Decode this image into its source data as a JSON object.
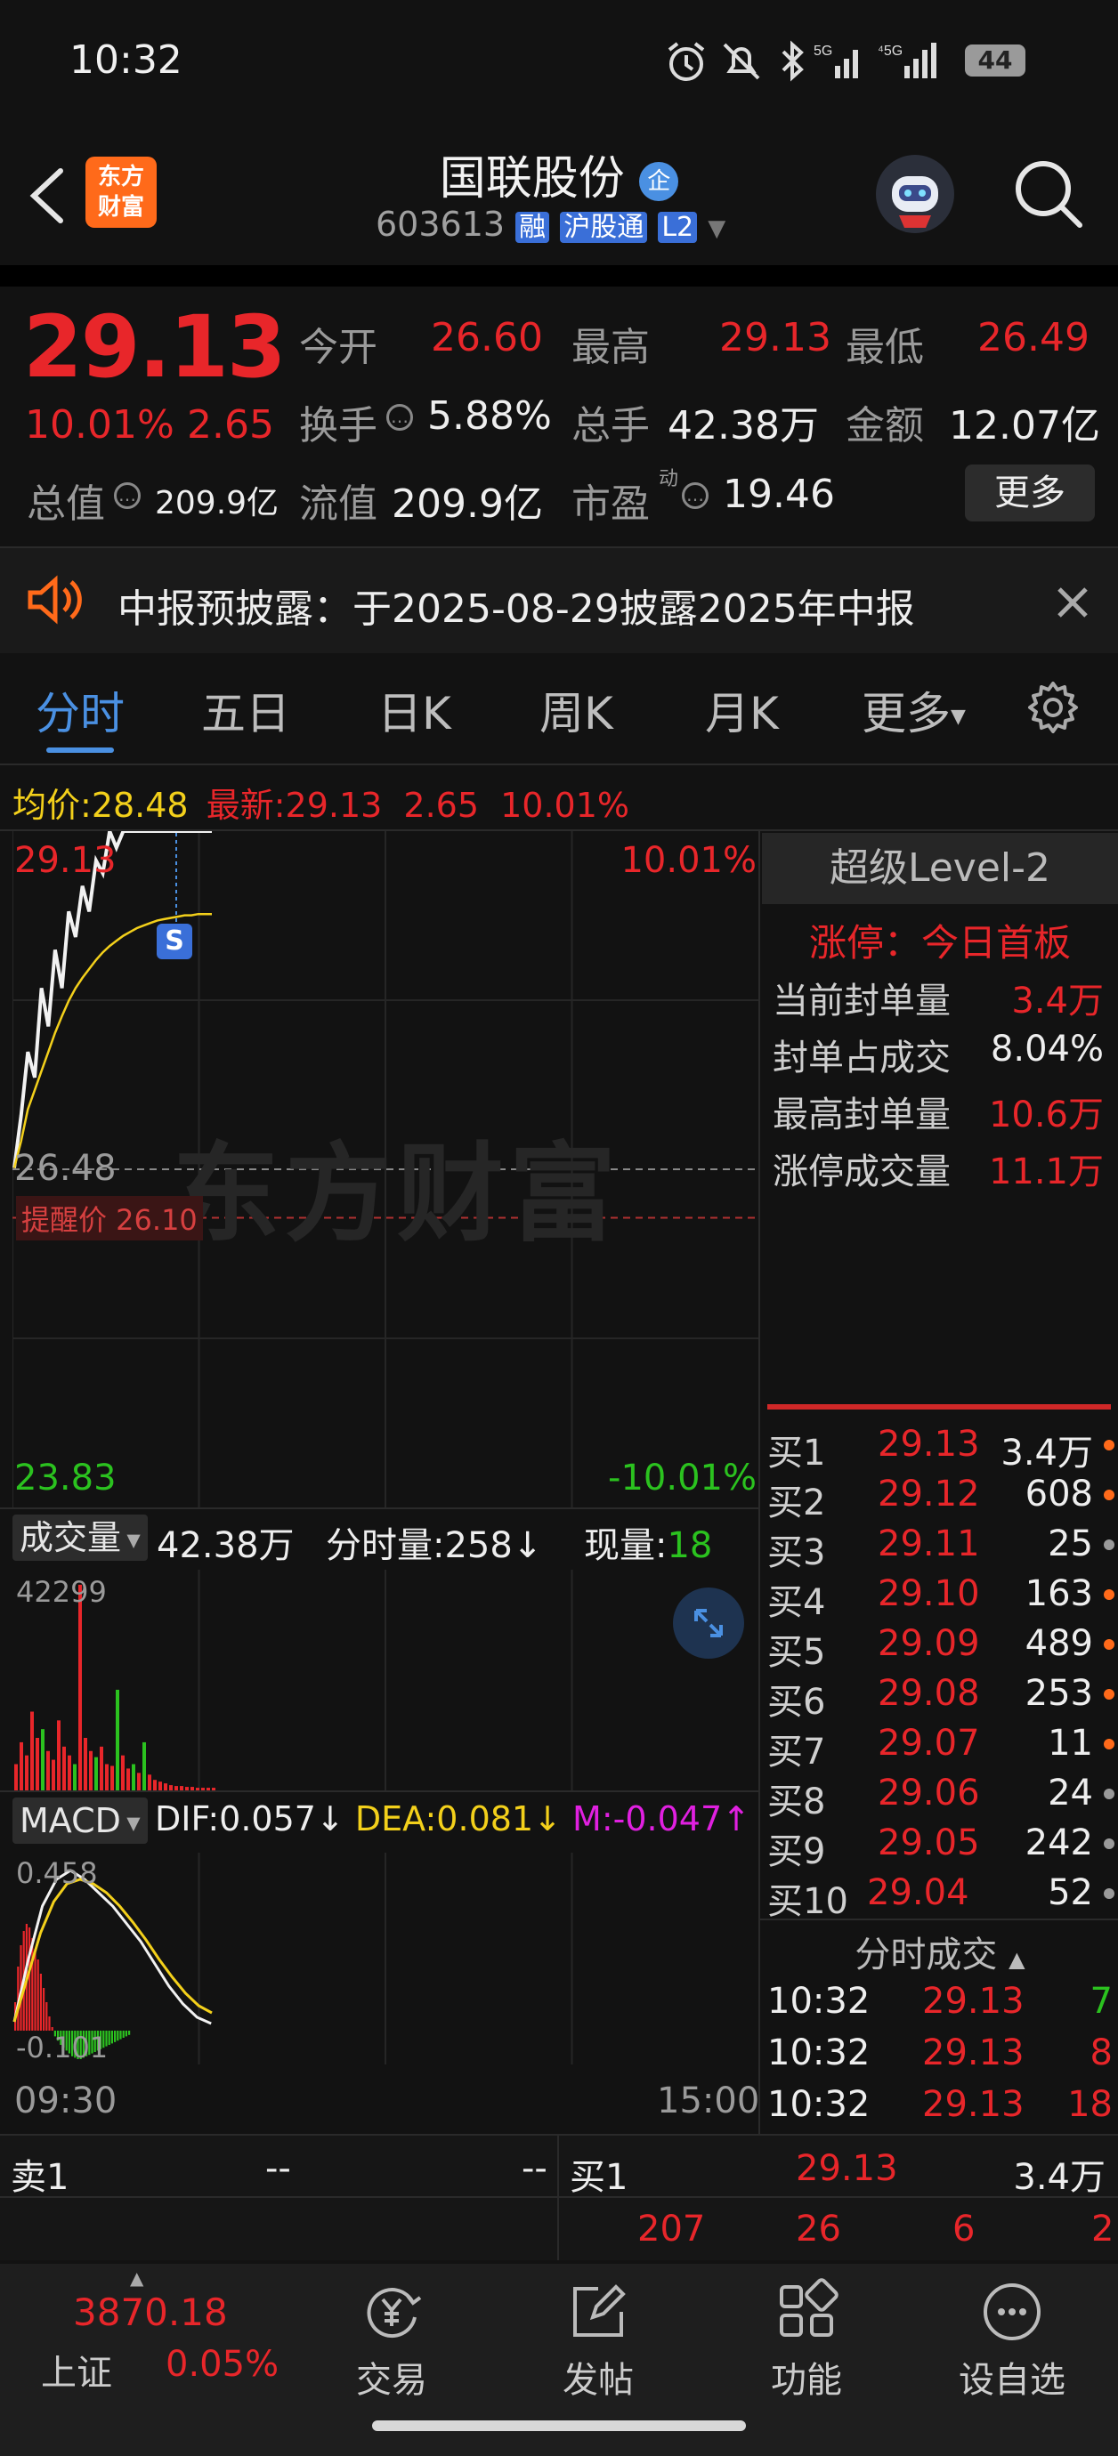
{
  "status_bar": {
    "time": "10:32",
    "battery": "44"
  },
  "header": {
    "title": "国联股份",
    "badge": "企",
    "code": "603613",
    "tags": [
      "融",
      "沪股通",
      "L2"
    ],
    "logo_line1": "东方",
    "logo_line2": "财富"
  },
  "quote": {
    "price": "29.13",
    "change_pct": "10.01%",
    "change": "2.65",
    "stats": [
      {
        "label": "今开",
        "value": "26.60"
      },
      {
        "label": "最高",
        "value": "29.13"
      },
      {
        "label": "最低",
        "value": "26.49"
      },
      {
        "label": "换手",
        "value": "5.88%"
      },
      {
        "label": "总手",
        "value": "42.38万"
      },
      {
        "label": "金额",
        "value": "12.07亿"
      },
      {
        "label": "总值",
        "value": "209.9亿"
      },
      {
        "label": "流值",
        "value": "209.9亿"
      },
      {
        "label": "市盈",
        "value": "19.46",
        "sup": "动"
      }
    ],
    "more_button": "更多"
  },
  "notice": {
    "text": "中报预披露：于2025-08-29披露2025年中报"
  },
  "tabs": [
    "分时",
    "五日",
    "日K",
    "周K",
    "月K",
    "更多"
  ],
  "chart_info": {
    "avg_label": "均价:",
    "avg_value": "28.48",
    "latest_label": "最新:",
    "latest_value": "29.13",
    "latest_change": "2.65",
    "latest_pct": "10.01%"
  },
  "chart_data": {
    "type": "line",
    "price_axis": {
      "top": "29.13",
      "mid": "26.48",
      "bottom": "23.83",
      "top_pct": "10.01%",
      "bottom_pct": "-10.01%"
    },
    "alert_line": "提醒价 26.10",
    "marker": "S",
    "time_axis": {
      "start": "09:30",
      "end": "15:00"
    },
    "watermark": "东方财富",
    "price_series": [
      {
        "name": "price",
        "values": [
          26.49,
          26.9,
          27.4,
          27.2,
          27.9,
          27.6,
          28.2,
          27.9,
          28.5,
          28.3,
          28.7,
          28.5,
          28.9,
          28.8,
          29.13,
          29.0,
          29.13,
          29.13,
          29.13,
          29.13,
          29.13,
          29.13,
          29.13,
          29.13,
          29.13,
          29.13,
          29.13,
          29.13,
          29.13,
          29.13
        ]
      },
      {
        "name": "avg",
        "values": [
          26.49,
          26.7,
          26.95,
          27.1,
          27.25,
          27.4,
          27.55,
          27.68,
          27.8,
          27.9,
          27.98,
          28.05,
          28.12,
          28.18,
          28.23,
          28.27,
          28.31,
          28.34,
          28.37,
          28.39,
          28.41,
          28.43,
          28.44,
          28.45,
          28.46,
          28.47,
          28.47,
          28.48,
          28.48,
          28.48
        ]
      }
    ],
    "volume": {
      "label": "成交量",
      "total": "42.38万",
      "bar_label": "分时量:",
      "bar_value": "258",
      "now_label": "现量:",
      "now_value": "18",
      "max": "42299"
    },
    "macd": {
      "label": "MACD",
      "dif": "DIF:0.057",
      "dea": "DEA:0.081",
      "m": "M:-0.047",
      "top": "0.458",
      "bottom": "-0.101"
    }
  },
  "level2": {
    "title": "超级Level-2",
    "limit_label": "涨停：今日首板",
    "rows": [
      {
        "label": "当前封单量",
        "value": "3.4万"
      },
      {
        "label": "封单占成交",
        "value": "8.04%"
      },
      {
        "label": "最高封单量",
        "value": "10.6万"
      },
      {
        "label": "涨停成交量",
        "value": "11.1万"
      }
    ]
  },
  "order_book": [
    {
      "label": "买1",
      "price": "29.13",
      "vol": "3.4万",
      "dot": "#ff6a1a"
    },
    {
      "label": "买2",
      "price": "29.12",
      "vol": "608",
      "dot": "#ff6a1a"
    },
    {
      "label": "买3",
      "price": "29.11",
      "vol": "25",
      "dot": "#9a9a9a"
    },
    {
      "label": "买4",
      "price": "29.10",
      "vol": "163",
      "dot": "#ff6a1a"
    },
    {
      "label": "买5",
      "price": "29.09",
      "vol": "489",
      "dot": "#ff6a1a"
    },
    {
      "label": "买6",
      "price": "29.08",
      "vol": "253",
      "dot": "#ff6a1a"
    },
    {
      "label": "买7",
      "price": "29.07",
      "vol": "11",
      "dot": "#ff6a1a"
    },
    {
      "label": "买8",
      "price": "29.06",
      "vol": "24",
      "dot": "#9a9a9a"
    },
    {
      "label": "买9",
      "price": "29.05",
      "vol": "242",
      "dot": "#9a9a9a"
    },
    {
      "label": "买10",
      "price": "29.04",
      "vol": "52",
      "dot": "#9a9a9a"
    }
  ],
  "ticks": {
    "title": "分时成交",
    "rows": [
      {
        "time": "10:32",
        "price": "29.13",
        "vol": "7"
      },
      {
        "time": "10:32",
        "price": "29.13",
        "vol": "8"
      },
      {
        "time": "10:32",
        "price": "29.13",
        "vol": "18"
      }
    ]
  },
  "bottom_quote": {
    "sell_label": "卖1",
    "sell_price": "--",
    "sell_vol": "--",
    "buy_label": "买1",
    "buy_price": "29.13",
    "buy_vol": "3.4万",
    "numbers": [
      "207",
      "26",
      "6",
      "2"
    ]
  },
  "nav": {
    "index_value": "3870.18",
    "index_name": "上证",
    "index_pct": "0.05%",
    "items": [
      "交易",
      "发帖",
      "功能",
      "设自选"
    ]
  },
  "colors": {
    "red": "#e8262a",
    "green": "#2bc21f",
    "yellow": "#f3d01b",
    "accent": "#4a90e2",
    "orange": "#ff6a1a"
  }
}
